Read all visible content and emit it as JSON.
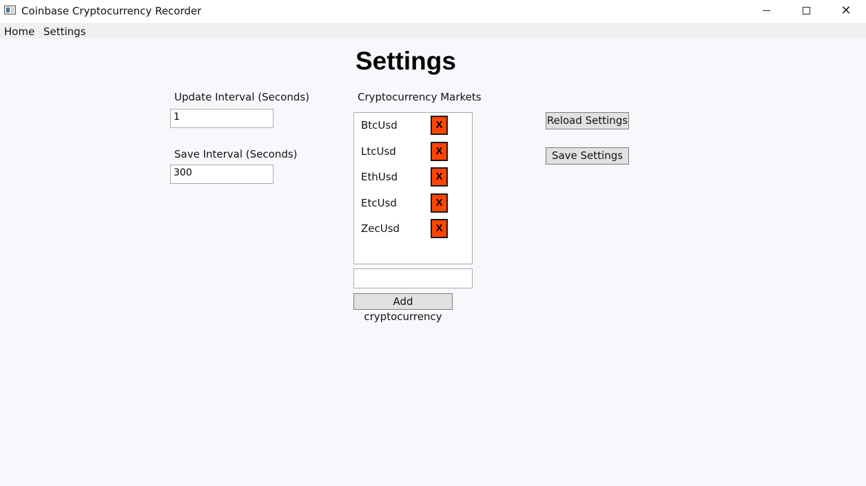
{
  "window": {
    "title": "Coinbase Cryptocurrency Recorder",
    "controls": {
      "minimize": "",
      "maximize": "",
      "close": "✕"
    }
  },
  "menu": {
    "items": [
      "Home",
      "Settings"
    ]
  },
  "page": {
    "title": "Settings"
  },
  "update_interval": {
    "label": "Update Interval (Seconds)",
    "value": "1"
  },
  "save_interval": {
    "label": "Save Interval  (Seconds)",
    "value": "300"
  },
  "markets": {
    "label": "Cryptocurrency Markets",
    "items": [
      {
        "name": "BtcUsd",
        "remove": "X"
      },
      {
        "name": "LtcUsd",
        "remove": "X"
      },
      {
        "name": "EthUsd",
        "remove": "X"
      },
      {
        "name": "EtcUsd",
        "remove": "X"
      },
      {
        "name": "ZecUsd",
        "remove": "X"
      }
    ],
    "new_value": "",
    "add_label": "Add cryptocurrency"
  },
  "actions": {
    "reload_label": "Reload Settings",
    "save_label": "Save Settings"
  },
  "colors": {
    "remove_button": "#ff4500",
    "background": "#f7f8fc",
    "menubar": "#f0f0f0"
  }
}
